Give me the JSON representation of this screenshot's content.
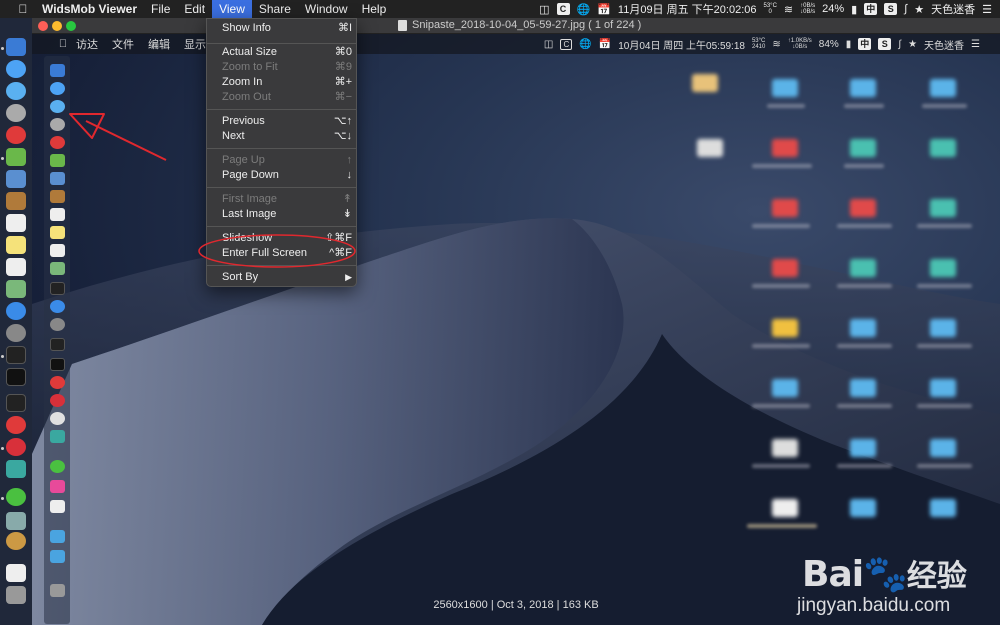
{
  "menubar": {
    "app_name": "WidsMob Viewer",
    "items": [
      "File",
      "Edit",
      "View",
      "Share",
      "Window",
      "Help"
    ],
    "active_item": "View",
    "status": {
      "c_badge": "C",
      "datetime": "11月09日 周五 下午20:02:06",
      "temp": "53°C",
      "temp_sub": "0",
      "net_up": "↑0B/s",
      "net_down": "↓0B/s",
      "battery": "24%",
      "input_method": "中",
      "s_badge": "S",
      "user": "天色迷香"
    }
  },
  "window": {
    "title": "Snipaste_2018-10-04_05-59-27.jpg ( 1 of 224 )"
  },
  "inner_screenshot": {
    "menu": [
      "访达",
      "文件",
      "编辑",
      "显示"
    ],
    "status": {
      "datetime": "10月04日 周四 上午05:59:18",
      "temp": "53°C",
      "temp_sub": "2410",
      "net_up": "↑1.0KB/s",
      "net_down": "↓0B/s",
      "battery": "84%",
      "input_method": "中",
      "s_badge": "S",
      "user": "天色迷香"
    }
  },
  "view_menu": {
    "items": [
      {
        "label": "Show Info",
        "shortcut": "⌘I",
        "disabled": false
      },
      {
        "label": "Actual Size",
        "shortcut": "⌘0",
        "disabled": false
      },
      {
        "label": "Zoom to Fit",
        "shortcut": "⌘9",
        "disabled": true
      },
      {
        "label": "Zoom In",
        "shortcut": "⌘+",
        "disabled": false
      },
      {
        "label": "Zoom Out",
        "shortcut": "⌘−",
        "disabled": true
      },
      {
        "label": "Previous",
        "shortcut": "⌥↑",
        "disabled": false
      },
      {
        "label": "Next",
        "shortcut": "⌥↓",
        "disabled": false
      },
      {
        "label": "Page Up",
        "shortcut": "↑",
        "disabled": true
      },
      {
        "label": "Page Down",
        "shortcut": "↓",
        "disabled": false
      },
      {
        "label": "First Image",
        "shortcut": "↟",
        "disabled": true
      },
      {
        "label": "Last Image",
        "shortcut": "↡",
        "disabled": false
      },
      {
        "label": "Slideshow",
        "shortcut": "⇧⌘F",
        "disabled": false
      },
      {
        "label": "Enter Full Screen",
        "shortcut": "^⌘F",
        "disabled": false
      },
      {
        "label": "Sort By",
        "shortcut": "▶",
        "disabled": false
      }
    ]
  },
  "image_info": "2560x1600 | Oct 3, 2018 | 163 KB",
  "watermark": {
    "brand_latin": "Bai",
    "brand_paw": "du",
    "brand_cn": "经验",
    "domain": "jingyan.baidu.com"
  },
  "colors": {
    "menu_highlight": "#3b6fe0",
    "annotation": "#e0282e"
  }
}
